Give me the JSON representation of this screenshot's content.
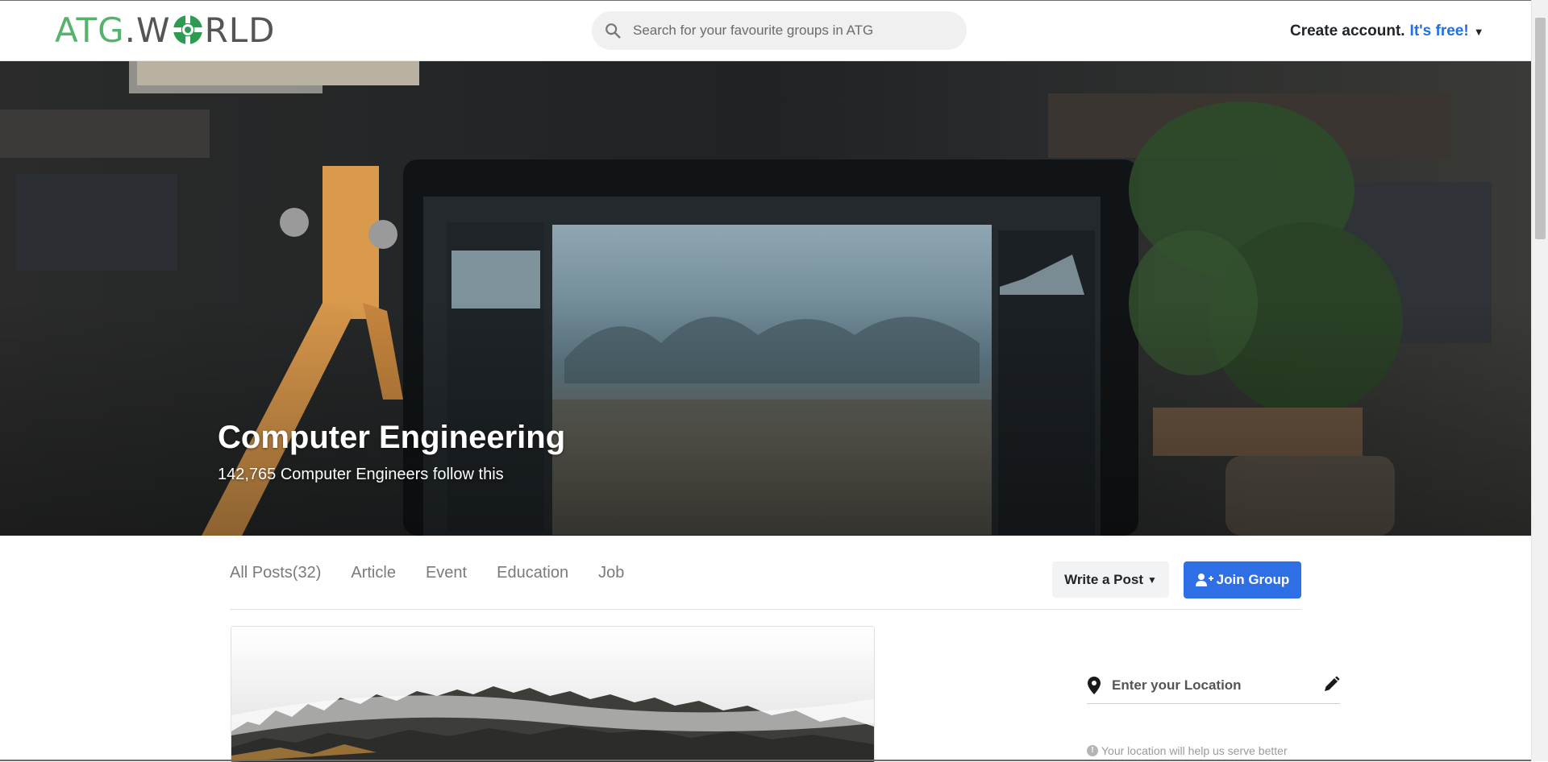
{
  "header": {
    "logo": {
      "part1": "ATG",
      "dot": ".",
      "w": "W",
      "rest": "RLD"
    },
    "search_placeholder": "Search for your favourite groups in ATG",
    "create_account": "Create account.",
    "free": "It's free!"
  },
  "hero": {
    "title": "Computer Engineering",
    "subtitle": "142,765 Computer Engineers follow this"
  },
  "tabs": [
    {
      "label": "All Posts(32)"
    },
    {
      "label": "Article"
    },
    {
      "label": "Event"
    },
    {
      "label": "Education"
    },
    {
      "label": "Job"
    }
  ],
  "actions": {
    "write_post": "Write a Post",
    "join_group": "Join Group"
  },
  "location": {
    "placeholder": "Enter your Location",
    "hint": "Your location will help us serve better"
  },
  "colors": {
    "brand_green": "#55b36b",
    "accent_blue": "#2f6fe6",
    "link_blue": "#1f6fe5"
  },
  "icons": {
    "search": "search-icon",
    "caret": "caret-down-icon",
    "add_user": "user-plus-icon",
    "pin": "map-pin-icon",
    "pencil": "pencil-icon",
    "info": "info-icon"
  }
}
